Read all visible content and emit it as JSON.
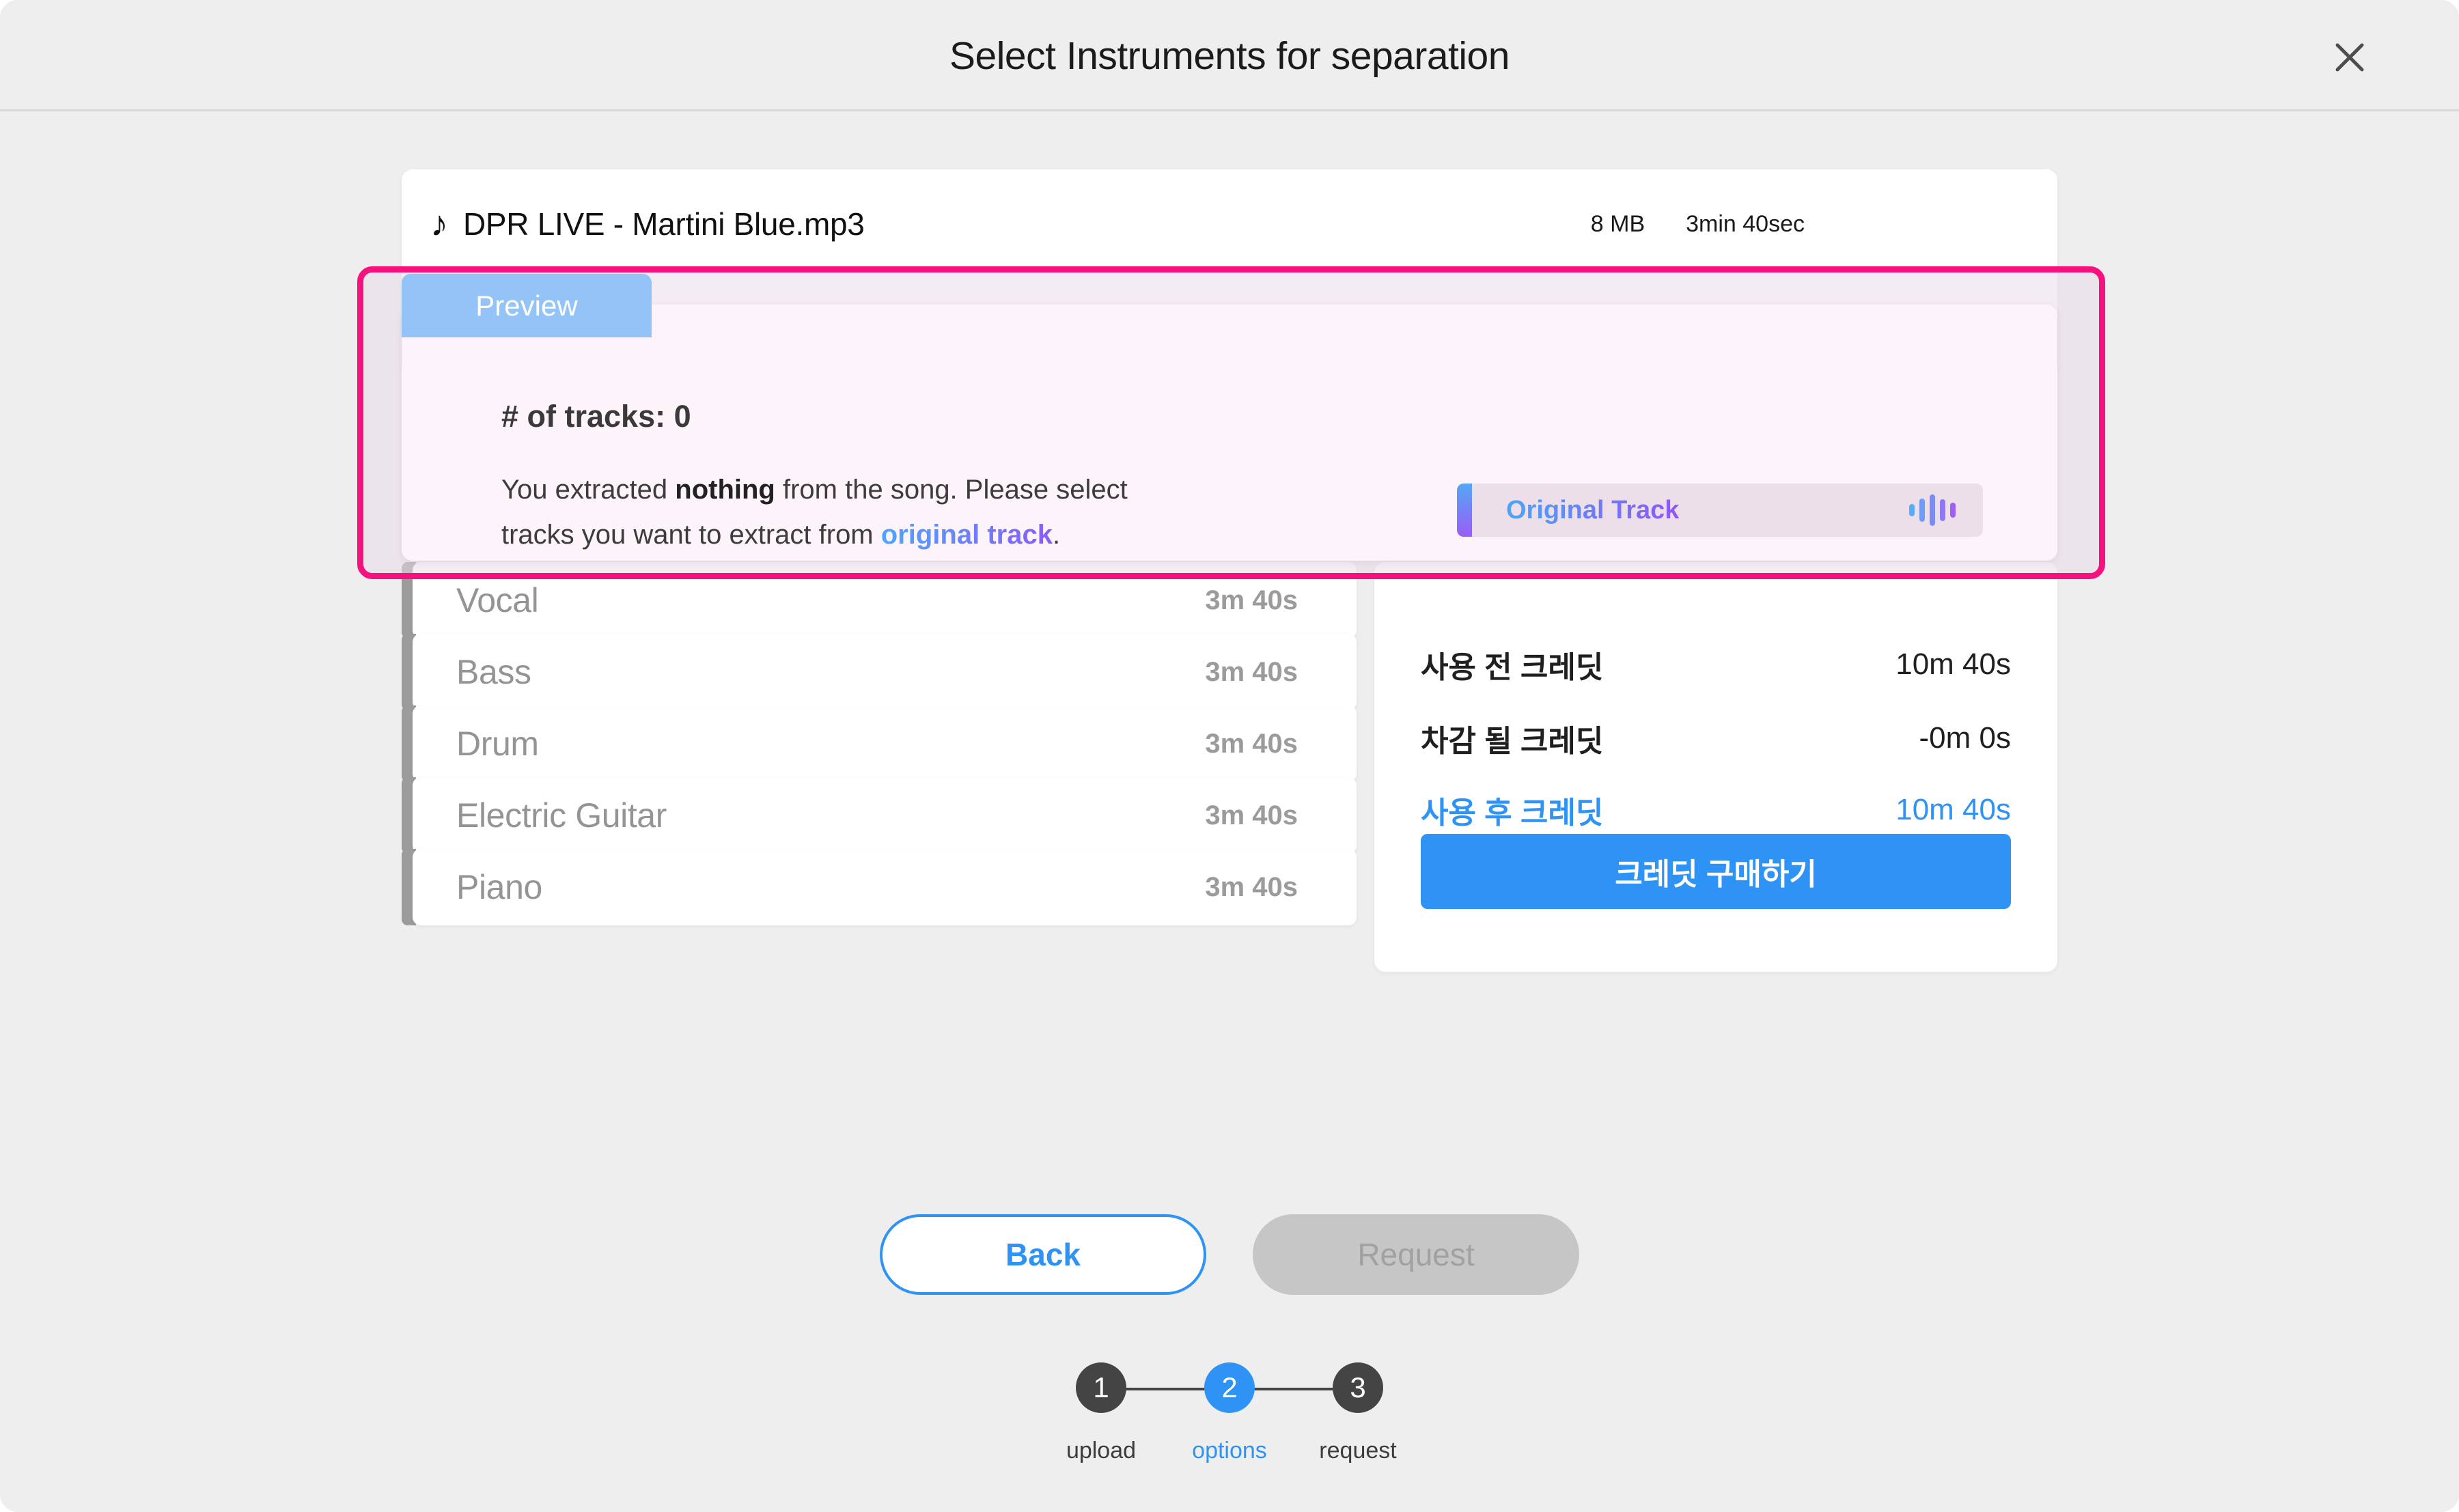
{
  "header": {
    "title": "Select Instruments for separation",
    "close_icon": "close-icon"
  },
  "file": {
    "icon": "music-note-icon",
    "name": "DPR LIVE - Martini Blue.mp3",
    "size": "8 MB",
    "duration": "3min 40sec"
  },
  "preview": {
    "tab_label": "Preview",
    "tracks_count_label": "# of tracks: 0",
    "desc_part1": "You extracted ",
    "desc_bold": "nothing",
    "desc_part2": " from the song. Please select tracks you want to extract from ",
    "desc_link": "original track",
    "desc_part3": ".",
    "original_chip_label": "Original Track",
    "waveform_icon": "waveform-icon"
  },
  "tracks": [
    {
      "name": "Vocal",
      "duration": "3m 40s"
    },
    {
      "name": "Bass",
      "duration": "3m 40s"
    },
    {
      "name": "Drum",
      "duration": "3m 40s"
    },
    {
      "name": "Electric Guitar",
      "duration": "3m 40s"
    },
    {
      "name": "Piano",
      "duration": "3m 40s"
    }
  ],
  "credits": {
    "rows": [
      {
        "label": "사용 전 크레딧",
        "value": "10m 40s"
      },
      {
        "label": "차감 될 크레딧",
        "value": "-0m 0s"
      },
      {
        "label": "사용 후 크레딧",
        "value": "10m 40s"
      }
    ],
    "buy_button": "크레딧 구매하기"
  },
  "footer": {
    "back_label": "Back",
    "request_label": "Request"
  },
  "stepper": {
    "steps": [
      {
        "num": "1",
        "label": "upload"
      },
      {
        "num": "2",
        "label": "options"
      },
      {
        "num": "3",
        "label": "request"
      }
    ]
  },
  "colors": {
    "accent_blue": "#2f93f5",
    "highlight_magenta": "#f5127f",
    "preview_tab_blue": "#94c4f7",
    "track_gray": "#9b9b9b",
    "gradient_start": "#4da6ff",
    "gradient_end": "#8b5cf6"
  }
}
